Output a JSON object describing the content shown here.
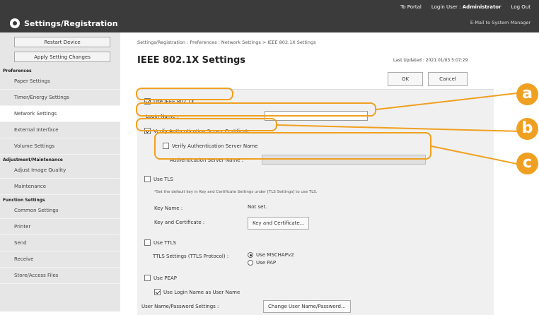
{
  "header": {
    "app_title": "Settings/Registration",
    "to_portal": "To Portal",
    "login_user_label": "Login User :",
    "login_user_name": "Administrator",
    "logout": "Log Out",
    "email_admin": "E-Mail to System Manager",
    "icon": "gear-icon"
  },
  "sidebar": {
    "restart_device": "Restart Device",
    "apply_changes": "Apply Setting Changes",
    "sections": [
      {
        "title": "Preferences",
        "items": [
          "Paper Settings",
          "Timer/Energy Settings",
          "Network Settings",
          "External Interface",
          "Volume Settings"
        ]
      },
      {
        "title": "Adjustment/Maintenance",
        "items": [
          "Adjust Image Quality",
          "Maintenance"
        ]
      },
      {
        "title": "Function Settings",
        "items": [
          "Common Settings",
          "Printer",
          "Send",
          "Receive",
          "Store/Access Files"
        ]
      }
    ],
    "selected": "Network Settings"
  },
  "main": {
    "breadcrumb": "Settings/Registration : Preferences : Network Settings > IEEE 802.1X Settings",
    "title": "IEEE 802.1X Settings",
    "last_updated": "Last Updated : 2021 01/03 5:07:29",
    "ok": "OK",
    "cancel": "Cancel"
  },
  "form": {
    "use_ieee": "Use IEEE 802.1X",
    "login_name_label": "Login Name :",
    "login_name_value": "",
    "verify_cert": "Verify Authentication Server Certificate",
    "verify_name": "Verify Authentication Server Name",
    "auth_server_name_label": "Authentication Server Name :",
    "auth_server_name_value": "",
    "use_tls": "Use TLS",
    "tls_note": "*Set the default key in Key and Certificate Settings under [TLS Settings] to use TLS.",
    "key_name_label": "Key Name :",
    "key_name_value": "Not set.",
    "key_cert_label": "Key and Certificate :",
    "key_cert_button": "Key and Certificate...",
    "use_ttls": "Use TTLS",
    "ttls_settings_label": "TTLS Settings (TTLS Protocol) :",
    "ttls_options": [
      "Use MSCHAPv2",
      "Use PAP"
    ],
    "use_peap": "Use PEAP",
    "use_login_as_user": "Use Login Name as User Name",
    "user_pw_label": "User Name/Password Settings :",
    "change_user_button": "Change User Name/Password..."
  },
  "callouts": {
    "a": "a",
    "b": "b",
    "c": "c",
    "color": "#f0a020"
  }
}
